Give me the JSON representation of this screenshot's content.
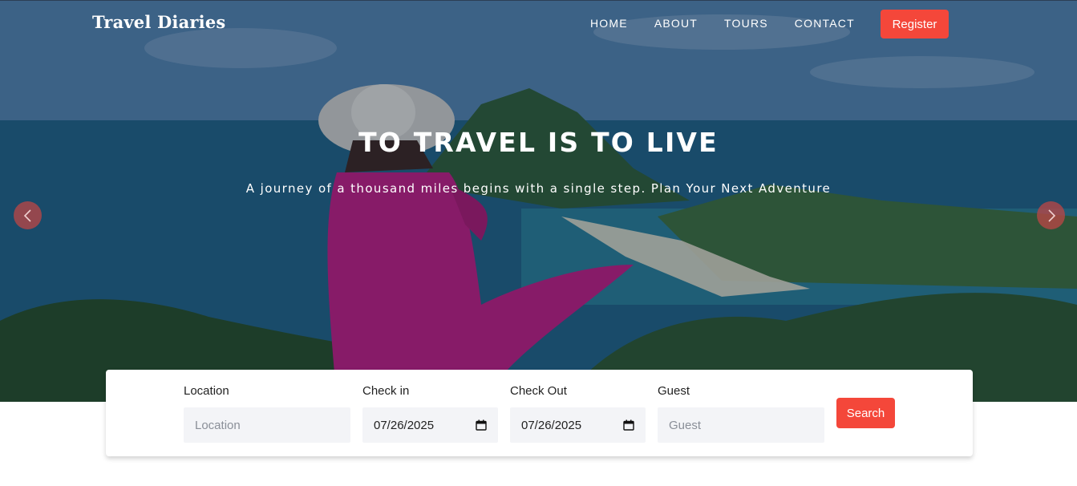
{
  "brand": {
    "name": "Travel Diaries"
  },
  "nav": {
    "items": [
      {
        "label": "HOME"
      },
      {
        "label": "ABOUT"
      },
      {
        "label": "TOURS"
      },
      {
        "label": "CONTACT"
      }
    ],
    "register_label": "Register"
  },
  "hero": {
    "title": "TO TRAVEL IS TO LIVE",
    "subtitle": "A journey of a thousand miles begins with a single step. Plan Your Next Adventure",
    "prev_icon": "chevron-left-icon",
    "next_icon": "chevron-right-icon"
  },
  "search": {
    "location": {
      "label": "Location",
      "placeholder": "Location",
      "value": ""
    },
    "checkin": {
      "label": "Check in",
      "value": "07/26/2025"
    },
    "checkout": {
      "label": "Check Out",
      "value": "07/26/2025"
    },
    "guest": {
      "label": "Guest",
      "placeholder": "Guest",
      "value": ""
    },
    "button_label": "Search"
  },
  "colors": {
    "accent": "#f4473a",
    "field_bg": "#f3f4f7"
  }
}
